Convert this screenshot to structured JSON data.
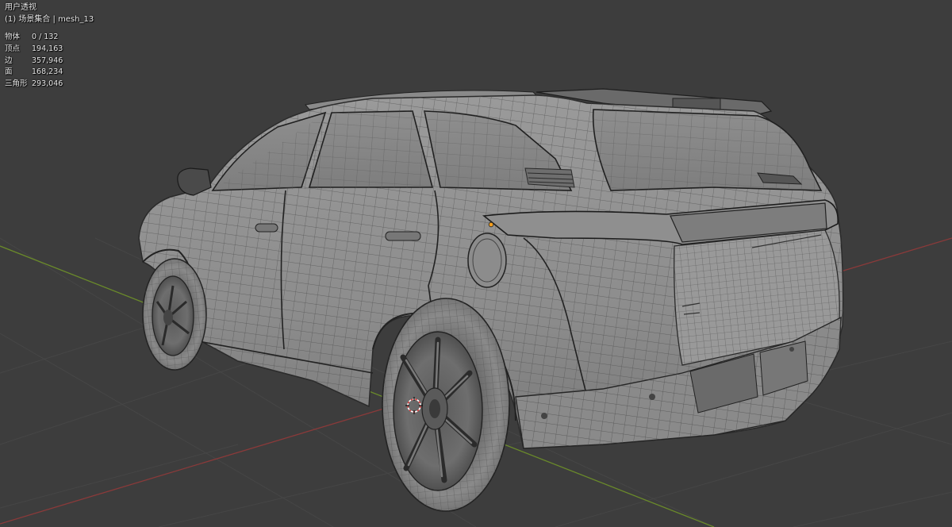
{
  "viewport": {
    "view_name": "用户透视",
    "collection_object": "(1) 场景集合 | mesh_13",
    "background": "#3d3d3d"
  },
  "stats": [
    {
      "label": "物体",
      "value": "0 / 132"
    },
    {
      "label": "顶点",
      "value": "194,163"
    },
    {
      "label": "边",
      "value": "357,946"
    },
    {
      "label": "面",
      "value": "168,234"
    },
    {
      "label": "三角形",
      "value": "293,046"
    }
  ],
  "axis_colors": {
    "x_axis": "#8a3a3a",
    "y_axis": "#6a8a2a"
  },
  "icons": [
    "3d-cursor-icon",
    "origin-point-icon"
  ]
}
